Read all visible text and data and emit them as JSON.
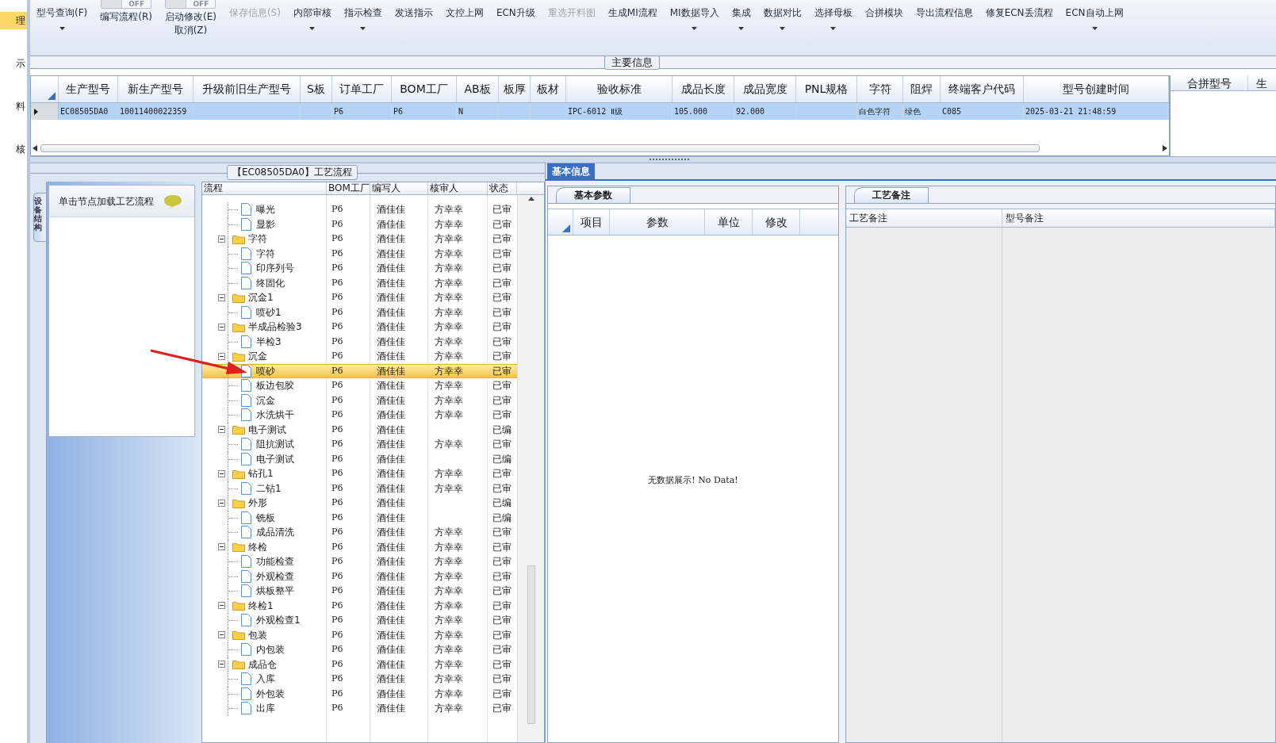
{
  "left_nav": [
    {
      "label": "理",
      "selected": true
    },
    {
      "label": "示",
      "selected": false
    },
    {
      "label": "料",
      "selected": false
    },
    {
      "label": "核",
      "selected": false
    }
  ],
  "toolbar": [
    {
      "label": "型号查询(F)",
      "has_menu": true,
      "disabled": false
    },
    {
      "label": "编写流程(R)",
      "toggle": "OFF",
      "has_menu": false,
      "disabled": false
    },
    {
      "label": "启动修改(E)",
      "sublabel": "取消(Z)",
      "toggle": "OFF",
      "has_menu": false,
      "disabled": false
    },
    {
      "label": "保存信息(S)",
      "has_menu": false,
      "disabled": true
    },
    {
      "label": "内部审核",
      "has_menu": true,
      "disabled": false
    },
    {
      "label": "指示检查",
      "has_menu": true,
      "disabled": false
    },
    {
      "label": "发送指示",
      "has_menu": false,
      "disabled": false
    },
    {
      "label": "文控上网",
      "has_menu": false,
      "disabled": false
    },
    {
      "label": "ECN升级",
      "has_menu": false,
      "disabled": false
    },
    {
      "label": "重选开料图",
      "has_menu": false,
      "disabled": true
    },
    {
      "label": "生成MI流程",
      "has_menu": false,
      "disabled": false
    },
    {
      "label": "MI数据导入",
      "has_menu": true,
      "disabled": false
    },
    {
      "label": "集成",
      "has_menu": true,
      "disabled": false
    },
    {
      "label": "数据对比",
      "has_menu": true,
      "disabled": false
    },
    {
      "label": "选择母板",
      "has_menu": true,
      "disabled": false
    },
    {
      "label": "合拼模块",
      "has_menu": false,
      "disabled": false
    },
    {
      "label": "导出流程信息",
      "has_menu": false,
      "disabled": false
    },
    {
      "label": "修复ECN丢流程",
      "has_menu": false,
      "disabled": false
    },
    {
      "label": "ECN自动上网",
      "has_menu": true,
      "disabled": false
    }
  ],
  "main_info": {
    "title": "主要信息",
    "columns": [
      "生产型号",
      "新生产型号",
      "升级前旧生产型号",
      "S板",
      "订单工厂",
      "BOM工厂",
      "AB板",
      "板厚",
      "板材",
      "验收标准",
      "成品长度",
      "成品宽度",
      "PNL规格",
      "字符",
      "阻焊",
      "终端客户代码",
      "型号创建时间"
    ],
    "rows": [
      {
        "selected": true,
        "cells": [
          "EC08505DA0",
          "10011400022359",
          "",
          "",
          "P6",
          "P6",
          "N",
          "",
          "",
          "IPC-6012 Ⅱ级",
          "105.000",
          "92.000",
          "",
          "白色字符",
          "绿色",
          "C085",
          "2025-03-21 21:48:59"
        ]
      }
    ],
    "side_columns": [
      "合拼型号",
      "生"
    ]
  },
  "process": {
    "title": "【EC08505DA0】工艺流程",
    "side_tab": "设备结构",
    "hint": "单击节点加载工艺流程",
    "columns": [
      "流程",
      "BOM工厂",
      "编写人",
      "核审人",
      "状态"
    ],
    "nodes": [
      {
        "children": [
          {
            "label": "曝光",
            "bom": "P6",
            "writer": "酒佳佳",
            "reviewer": "方幸幸",
            "status": "已审",
            "selected": false
          },
          {
            "label": "显影",
            "bom": "P6",
            "writer": "酒佳佳",
            "reviewer": "方幸幸",
            "status": "已审",
            "selected": false
          }
        ]
      },
      {
        "label": "字符",
        "bom": "P6",
        "writer": "酒佳佳",
        "reviewer": "方幸幸",
        "status": "已审",
        "selected": false,
        "expanded": true,
        "children": [
          {
            "label": "字符",
            "bom": "P6",
            "writer": "酒佳佳",
            "reviewer": "方幸幸",
            "status": "已审",
            "selected": false
          },
          {
            "label": "印序列号",
            "bom": "P6",
            "writer": "酒佳佳",
            "reviewer": "方幸幸",
            "status": "已审",
            "selected": false
          },
          {
            "label": "终固化",
            "bom": "P6",
            "writer": "酒佳佳",
            "reviewer": "方幸幸",
            "status": "已审",
            "selected": false
          }
        ]
      },
      {
        "label": "沉金1",
        "bom": "P6",
        "writer": "酒佳佳",
        "reviewer": "方幸幸",
        "status": "已审",
        "selected": false,
        "expanded": true,
        "children": [
          {
            "label": "喷砂1",
            "bom": "P6",
            "writer": "酒佳佳",
            "reviewer": "方幸幸",
            "status": "已审",
            "selected": false
          }
        ]
      },
      {
        "label": "半成品检验3",
        "bom": "P6",
        "writer": "酒佳佳",
        "reviewer": "方幸幸",
        "status": "已审",
        "selected": false,
        "expanded": true,
        "children": [
          {
            "label": "半检3",
            "bom": "P6",
            "writer": "酒佳佳",
            "reviewer": "方幸幸",
            "status": "已审",
            "selected": false
          }
        ]
      },
      {
        "label": "沉金",
        "bom": "P6",
        "writer": "酒佳佳",
        "reviewer": "方幸幸",
        "status": "已审",
        "selected": false,
        "expanded": true,
        "children": [
          {
            "label": "喷砂",
            "bom": "P6",
            "writer": "酒佳佳",
            "reviewer": "方幸幸",
            "status": "已审",
            "selected": true
          },
          {
            "label": "板边包胶",
            "bom": "P6",
            "writer": "酒佳佳",
            "reviewer": "方幸幸",
            "status": "已审",
            "selected": false
          },
          {
            "label": "沉金",
            "bom": "P6",
            "writer": "酒佳佳",
            "reviewer": "方幸幸",
            "status": "已审",
            "selected": false
          },
          {
            "label": "水洗烘干",
            "bom": "P6",
            "writer": "酒佳佳",
            "reviewer": "方幸幸",
            "status": "已审",
            "selected": false
          }
        ]
      },
      {
        "label": "电子测试",
        "bom": "P6",
        "writer": "酒佳佳",
        "status": "已编",
        "selected": false,
        "expanded": true,
        "children": [
          {
            "label": "阻抗测试",
            "bom": "P6",
            "writer": "酒佳佳",
            "reviewer": "方幸幸",
            "status": "已审",
            "selected": false
          },
          {
            "label": "电子测试",
            "bom": "P6",
            "writer": "酒佳佳",
            "status": "已编",
            "selected": false
          }
        ]
      },
      {
        "label": "钻孔1",
        "bom": "P6",
        "writer": "酒佳佳",
        "reviewer": "方幸幸",
        "status": "已审",
        "selected": false,
        "expanded": true,
        "children": [
          {
            "label": "二钻1",
            "bom": "P6",
            "writer": "酒佳佳",
            "reviewer": "方幸幸",
            "status": "已审",
            "selected": false
          }
        ]
      },
      {
        "label": "外形",
        "bom": "P6",
        "writer": "酒佳佳",
        "status": "已编",
        "selected": false,
        "expanded": true,
        "children": [
          {
            "label": "铣板",
            "bom": "P6",
            "writer": "酒佳佳",
            "status": "已编",
            "selected": false
          },
          {
            "label": "成品清洗",
            "bom": "P6",
            "writer": "酒佳佳",
            "reviewer": "方幸幸",
            "status": "已审",
            "selected": false
          }
        ]
      },
      {
        "label": "终检",
        "bom": "P6",
        "writer": "酒佳佳",
        "reviewer": "方幸幸",
        "status": "已审",
        "selected": false,
        "expanded": true,
        "children": [
          {
            "label": "功能检查",
            "bom": "P6",
            "writer": "酒佳佳",
            "reviewer": "方幸幸",
            "status": "已审",
            "selected": false
          },
          {
            "label": "外观检查",
            "bom": "P6",
            "writer": "酒佳佳",
            "reviewer": "方幸幸",
            "status": "已审",
            "selected": false
          },
          {
            "label": "烘板整平",
            "bom": "P6",
            "writer": "酒佳佳",
            "reviewer": "方幸幸",
            "status": "已审",
            "selected": false
          }
        ]
      },
      {
        "label": "终检1",
        "bom": "P6",
        "writer": "酒佳佳",
        "reviewer": "方幸幸",
        "status": "已审",
        "selected": false,
        "expanded": true,
        "children": [
          {
            "label": "外观检查1",
            "bom": "P6",
            "writer": "酒佳佳",
            "reviewer": "方幸幸",
            "status": "已审",
            "selected": false
          }
        ]
      },
      {
        "label": "包装",
        "bom": "P6",
        "writer": "酒佳佳",
        "reviewer": "方幸幸",
        "status": "已审",
        "selected": false,
        "expanded": true,
        "children": [
          {
            "label": "内包装",
            "bom": "P6",
            "writer": "酒佳佳",
            "reviewer": "方幸幸",
            "status": "已审",
            "selected": false
          }
        ]
      },
      {
        "label": "成品仓",
        "bom": "P6",
        "writer": "酒佳佳",
        "reviewer": "方幸幸",
        "status": "已审",
        "selected": false,
        "expanded": true,
        "children": [
          {
            "label": "入库",
            "bom": "P6",
            "writer": "酒佳佳",
            "reviewer": "方幸幸",
            "status": "已审",
            "selected": false
          },
          {
            "label": "外包装",
            "bom": "P6",
            "writer": "酒佳佳",
            "reviewer": "方幸幸",
            "status": "已审",
            "selected": false
          },
          {
            "label": "出库",
            "bom": "P6",
            "writer": "酒佳佳",
            "reviewer": "方幸幸",
            "status": "已审",
            "selected": false
          }
        ]
      }
    ]
  },
  "basic_info": {
    "tab": "基本信息",
    "params": {
      "tab": "基本参数",
      "columns": [
        "项目",
        "参数",
        "单位",
        "修改"
      ],
      "empty_text": "无数据展示! No Data!"
    },
    "remarks": {
      "tab": "工艺备注",
      "columns": [
        "工艺备注",
        "型号备注"
      ]
    }
  }
}
